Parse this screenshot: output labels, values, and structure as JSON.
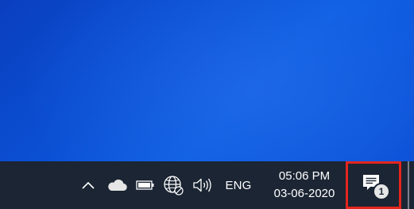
{
  "taskbar": {
    "tray": {
      "icons": [
        "chevron-up-icon",
        "onedrive-cloud-icon",
        "battery-icon",
        "network-globe-icon",
        "volume-icon"
      ],
      "language": "ENG",
      "time": "05:06 PM",
      "date": "03-06-2020",
      "notification_count": "1"
    }
  },
  "colors": {
    "desktop_blue": "#0b50d4",
    "taskbar_bg": "#1b2533",
    "highlight_red": "#e4261d",
    "badge_bg": "#e6e6e6"
  }
}
